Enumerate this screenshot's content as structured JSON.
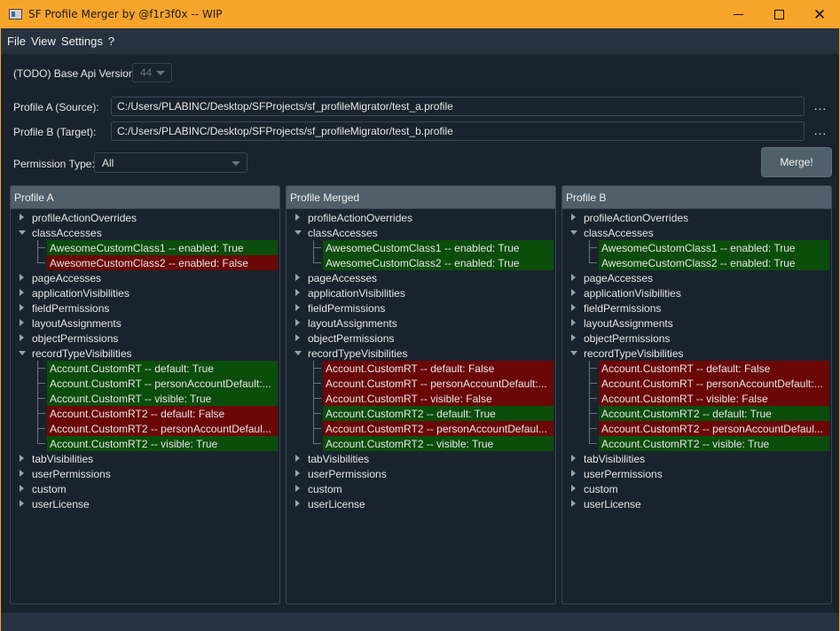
{
  "window": {
    "title": "SF Profile Merger by @f1r3f0x -- WIP",
    "accent": "#f7a42a",
    "minimize": "minimize-icon",
    "maximize": "maximize-icon",
    "close": "✕"
  },
  "menu": [
    "File",
    "View",
    "Settings",
    "?"
  ],
  "form": {
    "api_label": "(TODO) Base Api Version:",
    "api_value": "44",
    "profile_a_label": "Profile A (Source):",
    "profile_a_path": "C:/Users/PLABINC/Desktop/SFProjects/sf_profileMigrator/test_a.profile",
    "profile_b_label": "Profile B (Target):",
    "profile_b_path": "C:/Users/PLABINC/Desktop/SFProjects/sf_profileMigrator/test_b.profile",
    "browse": "...",
    "permission_label": "Permission Type:",
    "permission_value": "All",
    "merge": "Merge!"
  },
  "colors": {
    "enabled": "#0b4d0b",
    "disabled": "#6b0707"
  },
  "panels": [
    {
      "header": "Profile A",
      "items": [
        {
          "label": "profileActionOverrides",
          "expanded": false,
          "children": []
        },
        {
          "label": "classAccesses",
          "expanded": true,
          "children": [
            {
              "label": "AwesomeCustomClass1 -- enabled: True",
              "state": "green"
            },
            {
              "label": "AwesomeCustomClass2 -- enabled: False",
              "state": "red"
            }
          ]
        },
        {
          "label": "pageAccesses",
          "expanded": false,
          "children": []
        },
        {
          "label": "applicationVisibilities",
          "expanded": false,
          "children": []
        },
        {
          "label": "fieldPermissions",
          "expanded": false,
          "children": []
        },
        {
          "label": "layoutAssignments",
          "expanded": false,
          "children": []
        },
        {
          "label": "objectPermissions",
          "expanded": false,
          "children": []
        },
        {
          "label": "recordTypeVisibilities",
          "expanded": true,
          "children": [
            {
              "label": "Account.CustomRT -- default: True",
              "state": "green"
            },
            {
              "label": "Account.CustomRT -- personAccountDefault:...",
              "state": "green"
            },
            {
              "label": "Account.CustomRT -- visible: True",
              "state": "green"
            },
            {
              "label": "Account.CustomRT2 -- default: False",
              "state": "red"
            },
            {
              "label": "Account.CustomRT2 -- personAccountDefaul...",
              "state": "red"
            },
            {
              "label": "Account.CustomRT2 -- visible: True",
              "state": "green"
            }
          ]
        },
        {
          "label": "tabVisibilities",
          "expanded": false,
          "children": []
        },
        {
          "label": "userPermissions",
          "expanded": false,
          "children": []
        },
        {
          "label": "custom",
          "expanded": false,
          "children": []
        },
        {
          "label": "userLicense",
          "expanded": false,
          "children": []
        }
      ]
    },
    {
      "header": "Profile Merged",
      "items": [
        {
          "label": "profileActionOverrides",
          "expanded": false,
          "children": []
        },
        {
          "label": "classAccesses",
          "expanded": true,
          "children": [
            {
              "label": "AwesomeCustomClass1 -- enabled: True",
              "state": "green"
            },
            {
              "label": "AwesomeCustomClass2 -- enabled: True",
              "state": "green"
            }
          ]
        },
        {
          "label": "pageAccesses",
          "expanded": false,
          "children": []
        },
        {
          "label": "applicationVisibilities",
          "expanded": false,
          "children": []
        },
        {
          "label": "fieldPermissions",
          "expanded": false,
          "children": []
        },
        {
          "label": "layoutAssignments",
          "expanded": false,
          "children": []
        },
        {
          "label": "objectPermissions",
          "expanded": false,
          "children": []
        },
        {
          "label": "recordTypeVisibilities",
          "expanded": true,
          "children": [
            {
              "label": "Account.CustomRT -- default: False",
              "state": "red"
            },
            {
              "label": "Account.CustomRT -- personAccountDefault:...",
              "state": "red"
            },
            {
              "label": "Account.CustomRT -- visible: False",
              "state": "red"
            },
            {
              "label": "Account.CustomRT2 -- default: True",
              "state": "green"
            },
            {
              "label": "Account.CustomRT2 -- personAccountDefaul...",
              "state": "red"
            },
            {
              "label": "Account.CustomRT2 -- visible: True",
              "state": "green"
            }
          ]
        },
        {
          "label": "tabVisibilities",
          "expanded": false,
          "children": []
        },
        {
          "label": "userPermissions",
          "expanded": false,
          "children": []
        },
        {
          "label": "custom",
          "expanded": false,
          "children": []
        },
        {
          "label": "userLicense",
          "expanded": false,
          "children": []
        }
      ]
    },
    {
      "header": "Profile B",
      "items": [
        {
          "label": "profileActionOverrides",
          "expanded": false,
          "children": []
        },
        {
          "label": "classAccesses",
          "expanded": true,
          "children": [
            {
              "label": "AwesomeCustomClass1 -- enabled: True",
              "state": "green"
            },
            {
              "label": "AwesomeCustomClass2 -- enabled: True",
              "state": "green"
            }
          ]
        },
        {
          "label": "pageAccesses",
          "expanded": false,
          "children": []
        },
        {
          "label": "applicationVisibilities",
          "expanded": false,
          "children": []
        },
        {
          "label": "fieldPermissions",
          "expanded": false,
          "children": []
        },
        {
          "label": "layoutAssignments",
          "expanded": false,
          "children": []
        },
        {
          "label": "objectPermissions",
          "expanded": false,
          "children": []
        },
        {
          "label": "recordTypeVisibilities",
          "expanded": true,
          "children": [
            {
              "label": "Account.CustomRT -- default: False",
              "state": "red"
            },
            {
              "label": "Account.CustomRT -- personAccountDefault:...",
              "state": "red"
            },
            {
              "label": "Account.CustomRT -- visible: False",
              "state": "red"
            },
            {
              "label": "Account.CustomRT2 -- default: True",
              "state": "green"
            },
            {
              "label": "Account.CustomRT2 -- personAccountDefaul...",
              "state": "red"
            },
            {
              "label": "Account.CustomRT2 -- visible: True",
              "state": "green"
            }
          ]
        },
        {
          "label": "tabVisibilities",
          "expanded": false,
          "children": []
        },
        {
          "label": "userPermissions",
          "expanded": false,
          "children": []
        },
        {
          "label": "custom",
          "expanded": false,
          "children": []
        },
        {
          "label": "userLicense",
          "expanded": false,
          "children": []
        }
      ]
    }
  ]
}
